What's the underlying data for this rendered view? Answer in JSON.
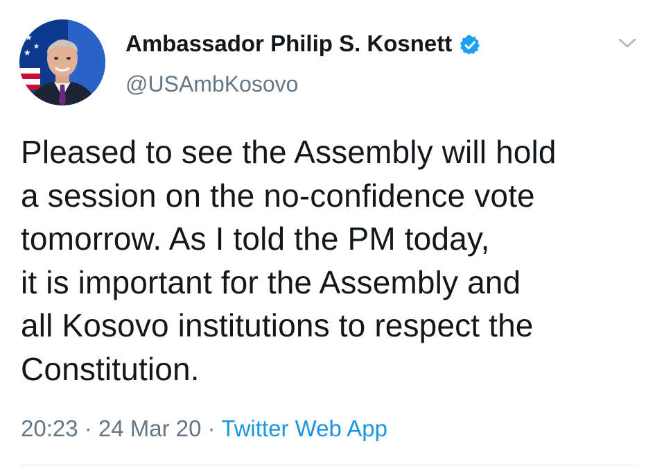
{
  "author": {
    "display_name": "Ambassador Philip S. Kosnett",
    "handle": "@USAmbKosovo",
    "verified": true
  },
  "tweet": {
    "text": "Pleased to see the Assembly will hold\na session on the no-confidence vote\ntomorrow.   As I told the PM today,\nit is important for the Assembly and\nall Kosovo institutions to respect the\nConstitution.",
    "time": "20:23",
    "separator": " · ",
    "date": "24 Mar 20",
    "source": "Twitter Web App"
  },
  "icons": {
    "verified": "verified-badge-icon",
    "caret": "chevron-down-icon"
  },
  "colors": {
    "verified_blue": "#1da1f2",
    "link_blue": "#1b95e0",
    "secondary_gray": "#657786",
    "text_dark": "#14171a"
  }
}
